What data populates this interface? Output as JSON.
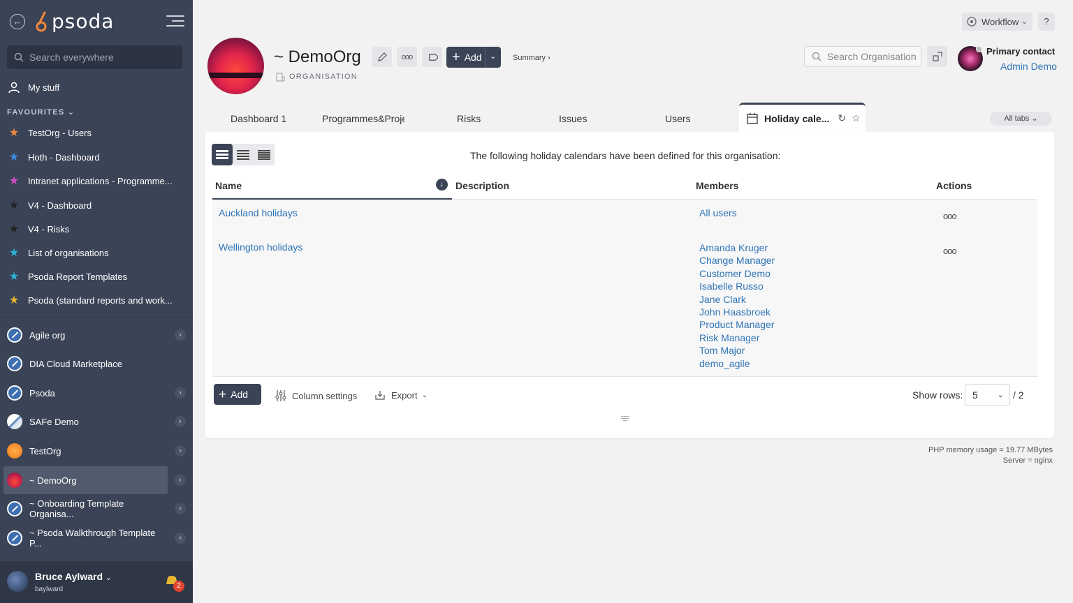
{
  "app": {
    "logo_text": "psoda"
  },
  "sidebar": {
    "search_placeholder": "Search everywhere",
    "my_stuff": "My stuff",
    "favourites_header": "FAVOURITES",
    "favourites": [
      {
        "label": "TestOrg - Users",
        "color": "#f0883e"
      },
      {
        "label": "Hoth - Dashboard",
        "color": "#3d8fe0"
      },
      {
        "label": "Intranet applications - Programme...",
        "color": "#d04fc9"
      },
      {
        "label": "V4 - Dashboard",
        "color": "#222222"
      },
      {
        "label": "V4 - Risks",
        "color": "#222222"
      },
      {
        "label": "List of organisations",
        "color": "#2bb3d9"
      },
      {
        "label": "Psoda Report Templates",
        "color": "#2bb3d9"
      },
      {
        "label": "Psoda (standard reports and work...",
        "color": "#e8b630"
      }
    ],
    "organisations": [
      {
        "label": "Agile org",
        "icon": "compass-icon",
        "chevron": true
      },
      {
        "label": "DIA Cloud Marketplace",
        "icon": "compass-icon",
        "chevron": false
      },
      {
        "label": "Psoda",
        "icon": "compass-icon",
        "chevron": true
      },
      {
        "label": "SAFe Demo",
        "icon": "safe-logo-icon",
        "chevron": true
      },
      {
        "label": "TestOrg",
        "icon": "orange-circle-icon",
        "chevron": true
      },
      {
        "label": "~ DemoOrg",
        "icon": "sunset-avatar-icon",
        "chevron": true,
        "active": true
      },
      {
        "label": "~ Onboarding Template Organisa...",
        "icon": "compass-icon",
        "chevron": true
      },
      {
        "label": "~ Psoda Walkthrough Template P...",
        "icon": "compass-icon",
        "chevron": true
      }
    ],
    "user": {
      "name": "Bruce Aylward",
      "login": "baylward",
      "notifications": "2"
    }
  },
  "header": {
    "org_name": "~ DemoOrg",
    "org_type": "ORGANISATION",
    "add_label": "Add",
    "summary_link": "Summary ›",
    "workflow_label": "Workflow",
    "help_label": "?",
    "search_placeholder": "Search Organisation",
    "primary_contact_label": "Primary contact",
    "primary_contact_name": "Admin Demo"
  },
  "tabs": {
    "items": [
      "Dashboard 1",
      "Programmes&Proje",
      "Risks",
      "Issues",
      "Users"
    ],
    "active": "Holiday cale...",
    "all_tabs": "All tabs"
  },
  "panel": {
    "intro": "The following holiday calendars have been defined for this organisation:",
    "columns": {
      "name": "Name",
      "description": "Description",
      "members": "Members",
      "actions": "Actions"
    },
    "rows": [
      {
        "name": "Auckland holidays",
        "members": [
          "All users"
        ]
      },
      {
        "name": "Wellington holidays",
        "members": [
          "Amanda Kruger",
          "Change Manager",
          "Customer Demo",
          "Isabelle Russo",
          "Jane Clark",
          "John Haasbroek",
          "Product Manager",
          "Risk Manager",
          "Tom Major",
          "demo_agile"
        ]
      }
    ],
    "actions_dots": "ooo",
    "add_label": "Add",
    "column_settings": "Column settings",
    "export": "Export",
    "show_rows_label": "Show rows:",
    "show_rows_value": "5",
    "total": "/ 2"
  },
  "footer": {
    "memory": "PHP memory usage = 19.77 MBytes",
    "server": "Server = nginx"
  },
  "colors": {
    "sidebar": "#3b4456",
    "link": "#2f75b5",
    "accent_orange": "#f0883e"
  }
}
